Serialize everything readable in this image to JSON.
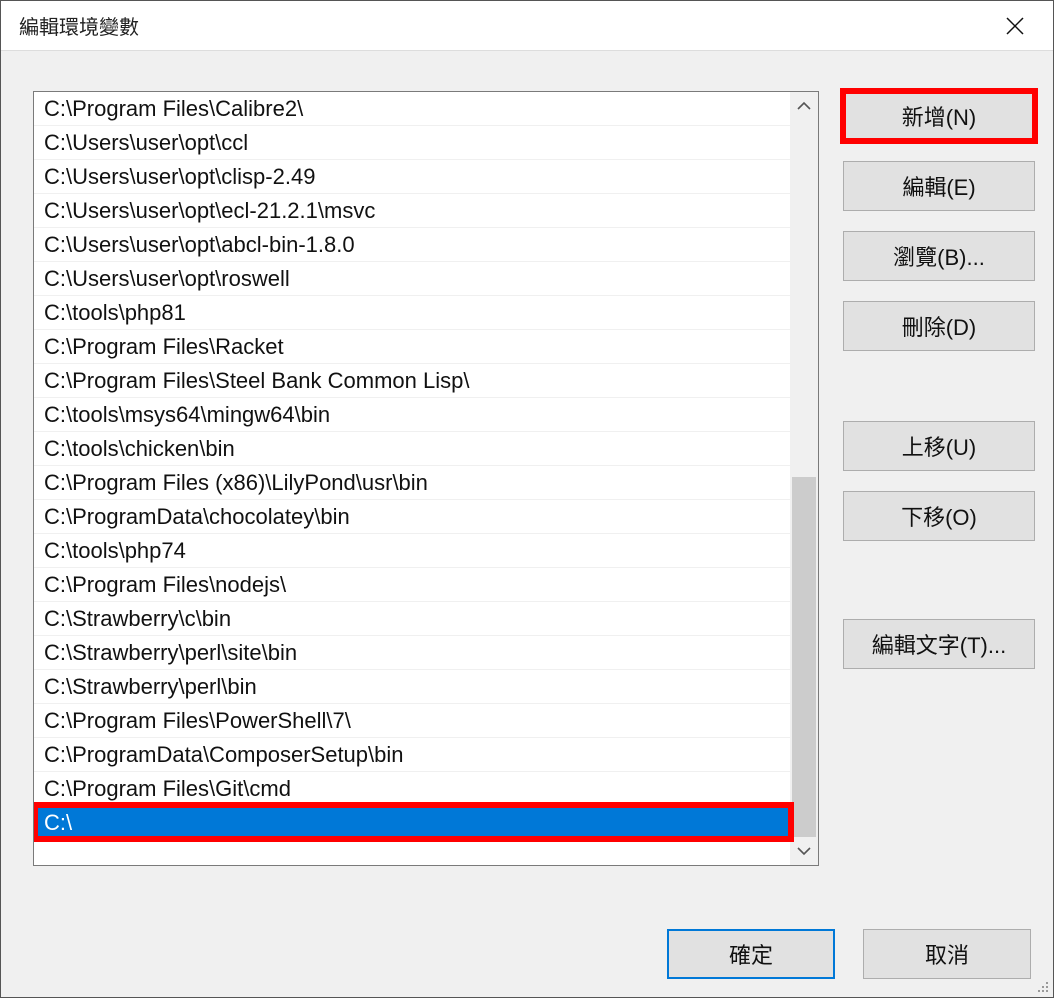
{
  "window": {
    "title": "編輯環境變數"
  },
  "list": {
    "items": [
      "C:\\Program Files\\Calibre2\\",
      "C:\\Users\\user\\opt\\ccl",
      "C:\\Users\\user\\opt\\clisp-2.49",
      "C:\\Users\\user\\opt\\ecl-21.2.1\\msvc",
      "C:\\Users\\user\\opt\\abcl-bin-1.8.0",
      "C:\\Users\\user\\opt\\roswell",
      "C:\\tools\\php81",
      "C:\\Program Files\\Racket",
      "C:\\Program Files\\Steel Bank Common Lisp\\",
      "C:\\tools\\msys64\\mingw64\\bin",
      "C:\\tools\\chicken\\bin",
      "C:\\Program Files (x86)\\LilyPond\\usr\\bin",
      "C:\\ProgramData\\chocolatey\\bin",
      "C:\\tools\\php74",
      "C:\\Program Files\\nodejs\\",
      "C:\\Strawberry\\c\\bin",
      "C:\\Strawberry\\perl\\site\\bin",
      "C:\\Strawberry\\perl\\bin",
      "C:\\Program Files\\PowerShell\\7\\",
      "C:\\ProgramData\\ComposerSetup\\bin",
      "C:\\Program Files\\Git\\cmd",
      "C:\\"
    ],
    "selected_index": 21
  },
  "buttons": {
    "new": "新增(N)",
    "edit": "編輯(E)",
    "browse": "瀏覽(B)...",
    "delete": "刪除(D)",
    "move_up": "上移(U)",
    "move_down": "下移(O)",
    "edit_text": "編輯文字(T)...",
    "ok": "確定",
    "cancel": "取消"
  }
}
